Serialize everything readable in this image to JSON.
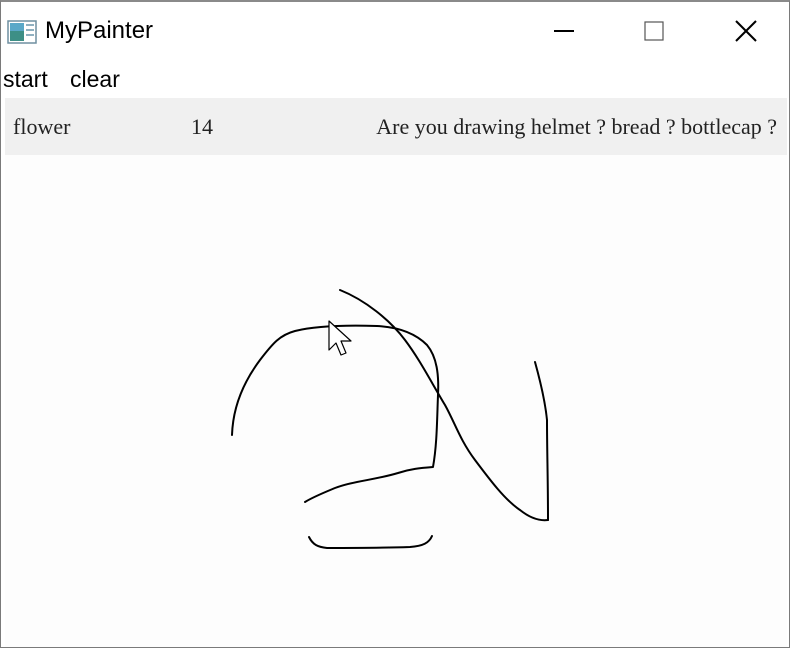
{
  "window": {
    "title": "MyPainter",
    "icon": "app-window-icon"
  },
  "titlebar_buttons": {
    "minimize_icon": "minimize-icon",
    "maximize_icon": "maximize-icon",
    "close_icon": "close-icon"
  },
  "menu": {
    "start_label": "start",
    "clear_label": "clear"
  },
  "info": {
    "word": "flower",
    "count": "14",
    "guess": "Are you drawing helmet ? bread ? bottlecap ?"
  },
  "canvas": {
    "stroke_color": "#000000",
    "background": "#fdfdfd",
    "cursor": "mouse-pointer-icon"
  }
}
